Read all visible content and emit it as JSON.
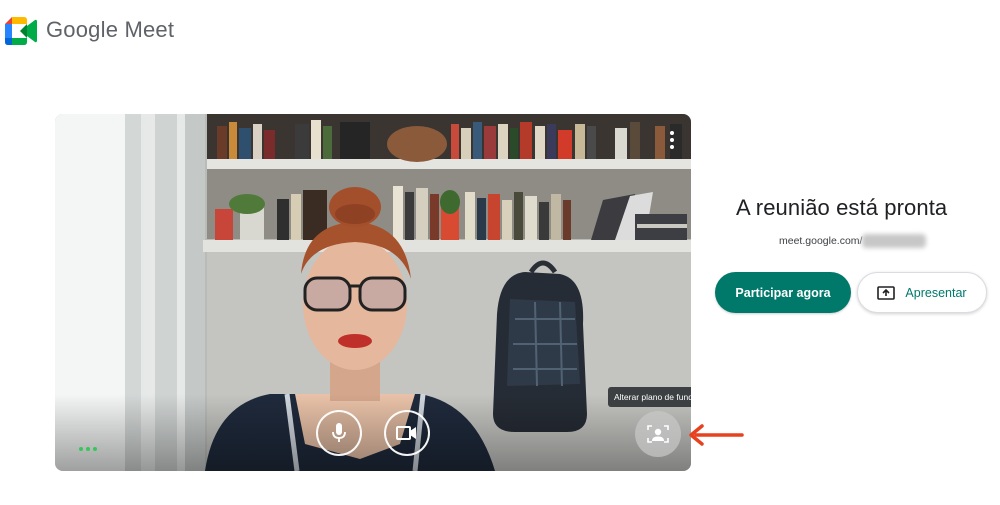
{
  "header": {
    "brand_name": "Google Meet",
    "logo_icon": "google-meet-logo-icon"
  },
  "video_preview": {
    "more_icon": "more-vertical-icon",
    "activity_icon": "audio-dots-icon",
    "controls": {
      "mic_icon": "microphone-icon",
      "camera_icon": "video-camera-icon",
      "background_icon": "change-background-icon"
    },
    "background_tooltip": "Alterar plano de fundo",
    "annotation_arrow_color": "#e8411f"
  },
  "right_panel": {
    "title": "A reunião está pronta",
    "meeting_url_prefix": "meet.google.com/",
    "join_label": "Participar agora",
    "present_label": "Apresentar",
    "present_icon": "present-screen-icon"
  },
  "colors": {
    "primary": "#00796b",
    "brand_text": "#5f6368",
    "activity_dots": "#34c759"
  }
}
